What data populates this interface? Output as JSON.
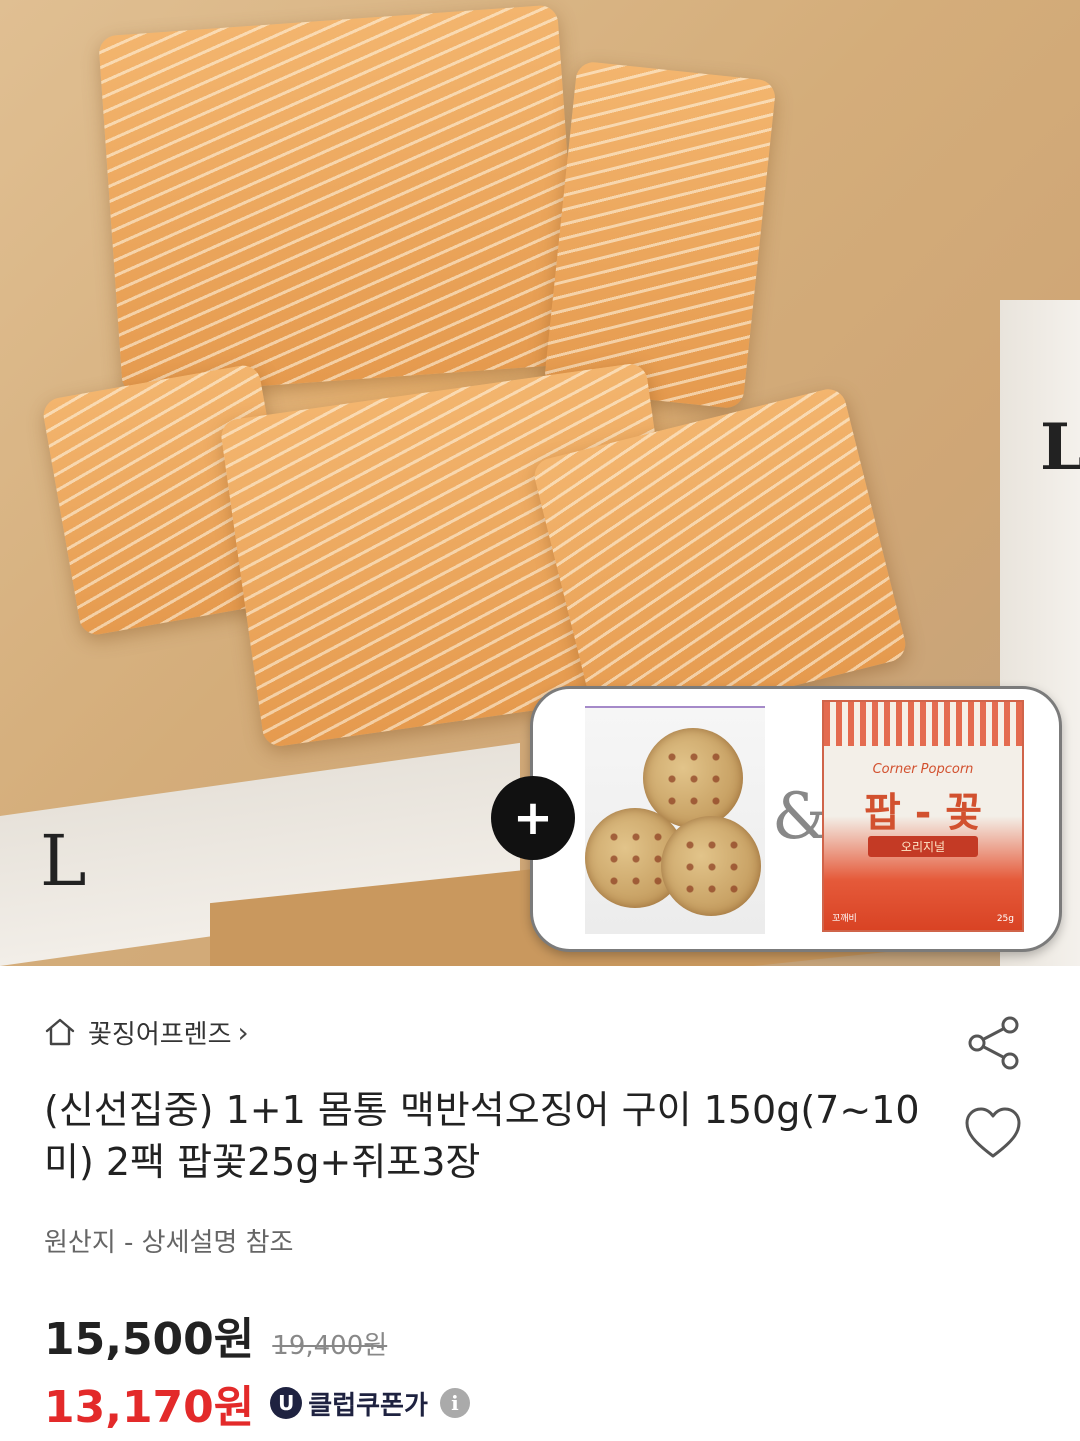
{
  "hero": {
    "add_label": "+",
    "amp_label": "&",
    "popcorn_bag": {
      "brand": "Corner Popcorn",
      "name": "팝 - 꽃",
      "flavor": "오리지널",
      "bottom_left": "꼬깨비",
      "bottom_right": "25g"
    },
    "newspaper_letters": [
      "L",
      "LUS"
    ]
  },
  "seller": {
    "name": "꽃징어프렌즈",
    "chevron": "›"
  },
  "product": {
    "title": "(신선집중)  1+1 몸통 맥반석오징어 구이 150g(7~10미) 2팩 팝꽃25g+쥐포3장",
    "origin": "원산지 - 상세설명 참조"
  },
  "pricing": {
    "price": "15,500원",
    "original_price": "19,400원",
    "coupon_price": "13,170원",
    "club_badge": "U",
    "club_label": "클럽쿠폰가",
    "info_glyph": "i"
  },
  "colors": {
    "coupon_red": "#e32a2a",
    "club_navy": "#1e2240",
    "text_dark": "#222222"
  },
  "icons": [
    "home-icon",
    "chevron-right-icon",
    "share-icon",
    "heart-icon",
    "info-icon",
    "plus-icon"
  ]
}
